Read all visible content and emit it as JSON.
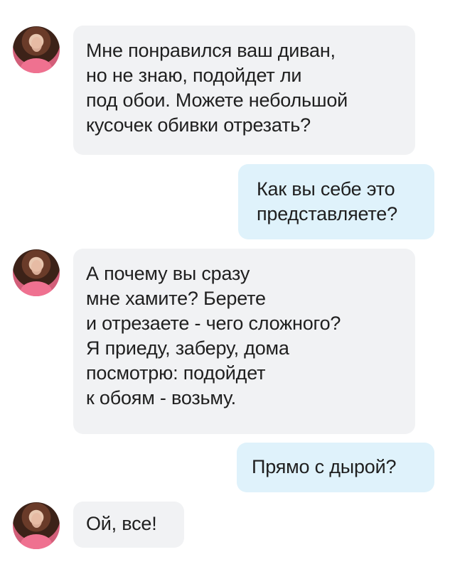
{
  "messages": [
    {
      "side": "incoming",
      "lines": [
        "Мне понравился ваш диван,",
        "но не знаю, подойдет ли",
        "под обои. Можете небольшой",
        "кусочек обивки отрезать?"
      ]
    },
    {
      "side": "outgoing",
      "lines": [
        "Как вы себе это",
        "представляете?"
      ]
    },
    {
      "side": "incoming",
      "lines": [
        "А почему вы сразу",
        "мне хамите? Берете",
        "и отрезаете - чего сложного?",
        "Я приеду, заберу, дома",
        "посмотрю: подойдет",
        "к обоям - возьму."
      ]
    },
    {
      "side": "outgoing",
      "lines": [
        "Прямо с дырой?"
      ]
    },
    {
      "side": "incoming",
      "lines": [
        "Ой, все!"
      ]
    }
  ],
  "colors": {
    "incoming_bubble": "#f1f2f4",
    "outgoing_bubble": "#dff2fb",
    "text": "#1f1f1f",
    "background": "#ffffff"
  },
  "icons": {
    "avatar": "user-avatar-icon"
  }
}
